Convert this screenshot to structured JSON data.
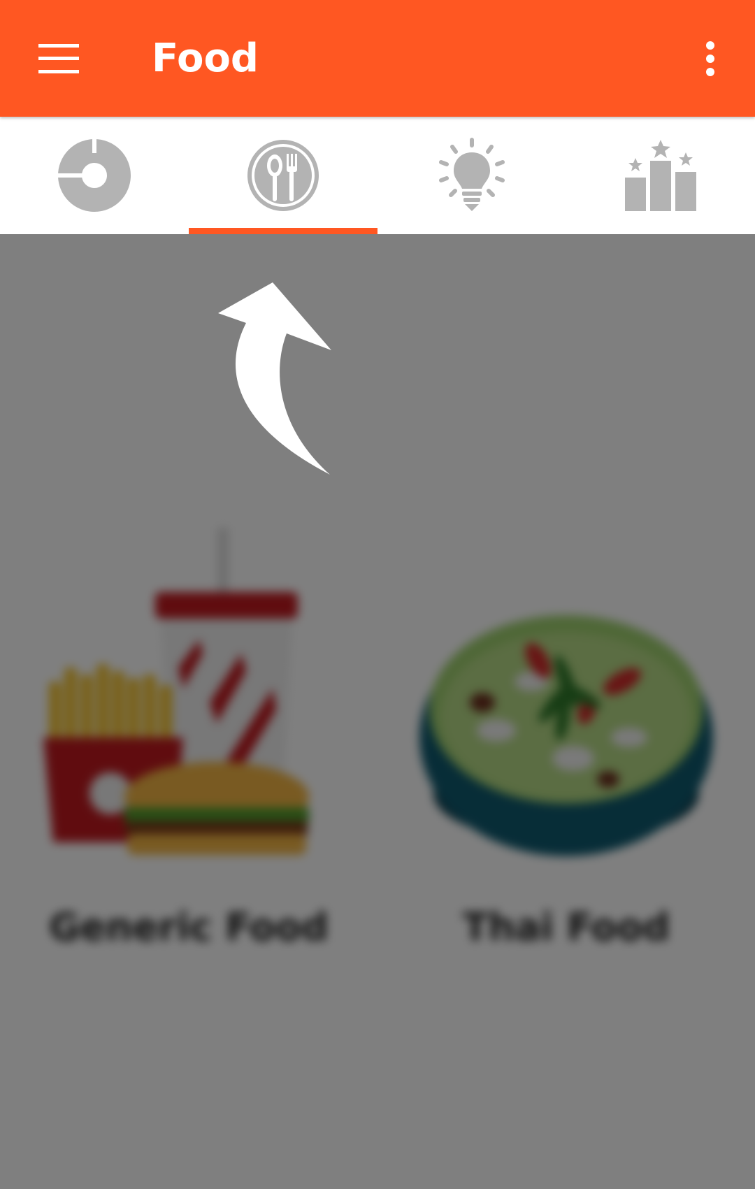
{
  "app_bar": {
    "title": "Food",
    "menu_icon": "hamburger-menu-icon",
    "overflow_icon": "more-vert-icon",
    "color": "#ff5722"
  },
  "tabs": [
    {
      "icon": "donut-chart-icon",
      "selected": false
    },
    {
      "icon": "plate-fork-spoon-icon",
      "selected": true
    },
    {
      "icon": "lightbulb-icon",
      "selected": false
    },
    {
      "icon": "podium-stars-icon",
      "selected": false
    }
  ],
  "foods": [
    {
      "label": "Generic Food",
      "icon": "fast-food-illustration"
    },
    {
      "label": "Thai Food",
      "icon": "thai-curry-bowl-illustration"
    }
  ],
  "overlay": {
    "hint_icon": "curved-arrow-up-icon"
  },
  "colors": {
    "accent": "#ff5722",
    "tab_icon": "#b3b3b3"
  }
}
